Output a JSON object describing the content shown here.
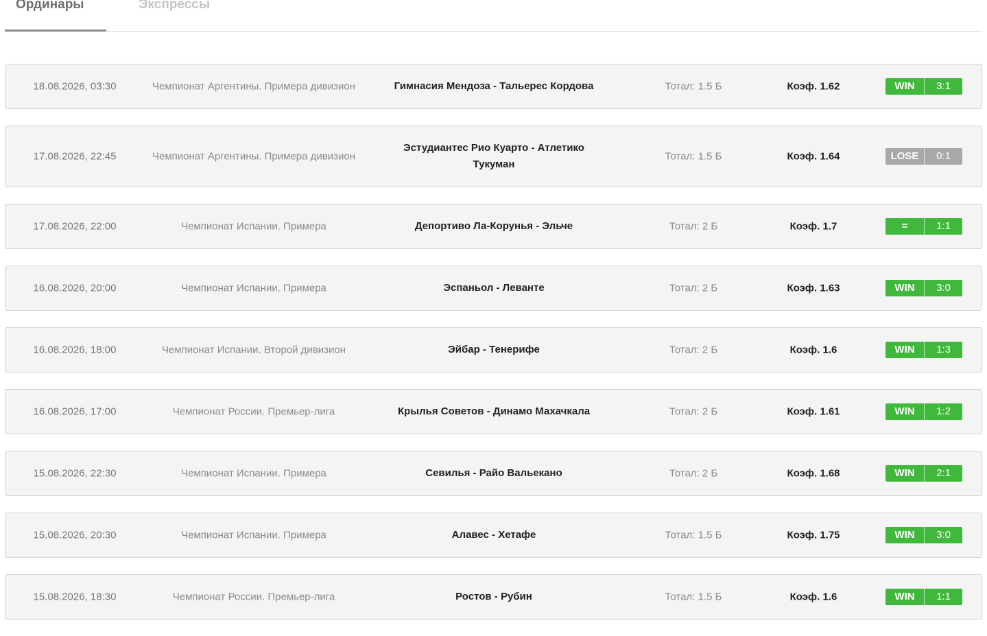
{
  "tabs": [
    {
      "label": "Ординары",
      "active": true
    },
    {
      "label": "Экспрессы",
      "active": false
    }
  ],
  "colors": {
    "win": "#3fb83c",
    "lose": "#a8a8a8"
  },
  "bets": [
    {
      "date": "18.08.2026, 03:30",
      "league": "Чемпионат Аргентины. Примера дивизион",
      "match": "Гимнасия Мендоза - Тальерес Кордова",
      "total": "Тотал: 1.5 Б",
      "coef": "Коэф. 1.62",
      "result": "WIN",
      "score": "3:1",
      "status": "win"
    },
    {
      "date": "17.08.2026, 22:45",
      "league": "Чемпионат Аргентины. Примера дивизион",
      "match": "Эстудиантес Рио Куарто - Атлетико Тукуман",
      "total": "Тотал: 1.5 Б",
      "coef": "Коэф. 1.64",
      "result": "LOSE",
      "score": "0:1",
      "status": "lose"
    },
    {
      "date": "17.08.2026, 22:00",
      "league": "Чемпионат Испании. Примера",
      "match": "Депортиво Ла-Корунья - Эльче",
      "total": "Тотал: 2 Б",
      "coef": "Коэф. 1.7",
      "result": "=",
      "score": "1:1",
      "status": "win"
    },
    {
      "date": "16.08.2026, 20:00",
      "league": "Чемпионат Испании. Примера",
      "match": "Эспаньол - Леванте",
      "total": "Тотал: 2 Б",
      "coef": "Коэф. 1.63",
      "result": "WIN",
      "score": "3:0",
      "status": "win"
    },
    {
      "date": "16.08.2026, 18:00",
      "league": "Чемпионат Испании. Второй дивизион",
      "match": "Эйбар - Тенерифе",
      "total": "Тотал: 2 Б",
      "coef": "Коэф. 1.6",
      "result": "WIN",
      "score": "1:3",
      "status": "win"
    },
    {
      "date": "16.08.2026, 17:00",
      "league": "Чемпионат России. Премьер-лига",
      "match": "Крылья Советов - Динамо Махачкала",
      "total": "Тотал: 2 Б",
      "coef": "Коэф. 1.61",
      "result": "WIN",
      "score": "1:2",
      "status": "win"
    },
    {
      "date": "15.08.2026, 22:30",
      "league": "Чемпионат Испании. Примера",
      "match": "Севилья - Райо Вальекано",
      "total": "Тотал: 2 Б",
      "coef": "Коэф. 1.68",
      "result": "WIN",
      "score": "2:1",
      "status": "win"
    },
    {
      "date": "15.08.2026, 20:30",
      "league": "Чемпионат Испании. Примера",
      "match": "Алавес - Хетафе",
      "total": "Тотал: 1.5 Б",
      "coef": "Коэф. 1.75",
      "result": "WIN",
      "score": "3:0",
      "status": "win"
    },
    {
      "date": "15.08.2026, 18:30",
      "league": "Чемпионат России. Премьер-лига",
      "match": "Ростов - Рубин",
      "total": "Тотал: 1.5 Б",
      "coef": "Коэф. 1.6",
      "result": "WIN",
      "score": "1:1",
      "status": "win"
    }
  ]
}
